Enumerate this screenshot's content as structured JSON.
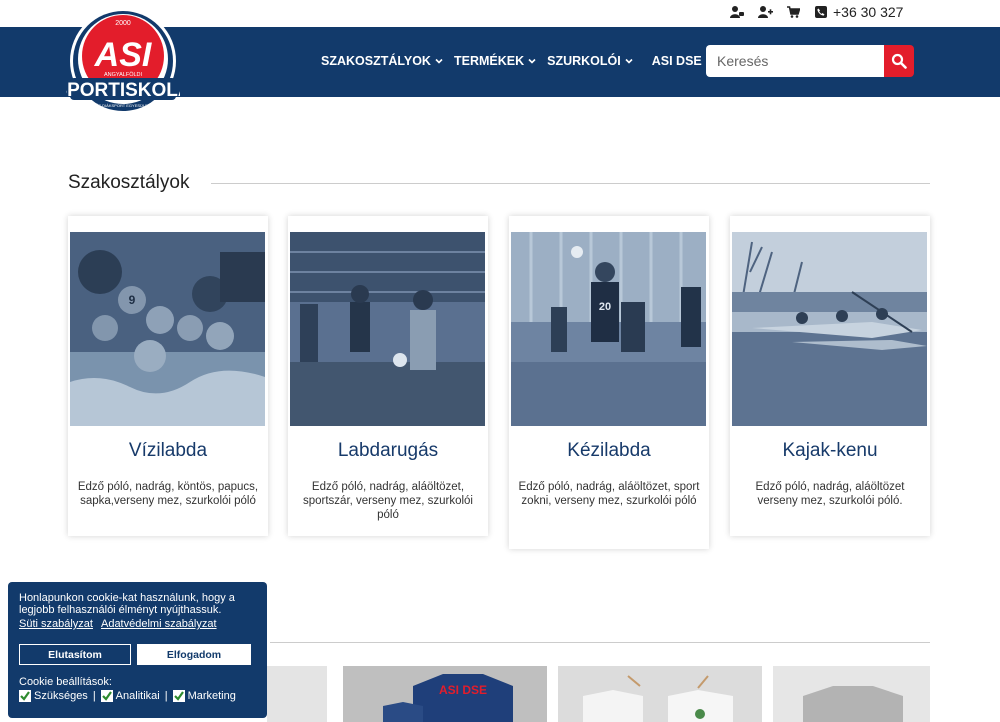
{
  "topbar": {
    "icons": [
      "user-login-icon",
      "user-add-icon",
      "cart-icon",
      "phone-icon"
    ],
    "phone": "+36 30 327"
  },
  "logo": {
    "year": "2000",
    "letters": "ASI",
    "line1": "ANGYALFÖLDI",
    "line2": "SPORTISKOLA",
    "line3": "ÉS DIÁKSPORT EGYESÜLET"
  },
  "nav": {
    "items": [
      {
        "label": "SZAKOSZTÁLYOK",
        "dropdown": true
      },
      {
        "label": "TERMÉKEK",
        "dropdown": true
      },
      {
        "label": "SZURKOLÓI",
        "dropdown": true
      },
      {
        "label": "ASI DSE",
        "dropdown": false
      }
    ]
  },
  "search": {
    "placeholder": "Keresés"
  },
  "section1": {
    "title": "Szakosztályok"
  },
  "cards": [
    {
      "title": "Vízilabda",
      "desc": "Edző póló, nadrág, köntös, papucs, sapka,verseny mez, szurkolói póló"
    },
    {
      "title": "Labdarugás",
      "desc": "Edző póló, nadrág, aláöltözet, sportszár, verseny mez, szurkolói póló"
    },
    {
      "title": "Kézilabda",
      "desc": "Edző póló, nadrág, aláöltözet, sport zokni, verseny mez, szurkolói póló"
    },
    {
      "title": "Kajak-kenu",
      "desc": "Edző póló, nadrág, aláöltözet verseny mez, szurkolói póló."
    }
  ],
  "products": {
    "shirt_print": "ASI DSE"
  },
  "cookie": {
    "text": "Honlapunkon cookie-kat használunk, hogy a legjobb felhasználói élményt nyújthassuk.",
    "link1": "Süti szabályzat",
    "link2": "Adatvédelmi szabályzat",
    "reject": "Elutasítom",
    "accept": "Elfogadom",
    "settings_label": "Cookie beállítások:",
    "options": [
      "Szükséges",
      "Analitikai",
      "Marketing"
    ],
    "separator": "|"
  },
  "colors": {
    "navy": "#123a6b",
    "red": "#e31d2b",
    "card_title": "#173a6a"
  }
}
